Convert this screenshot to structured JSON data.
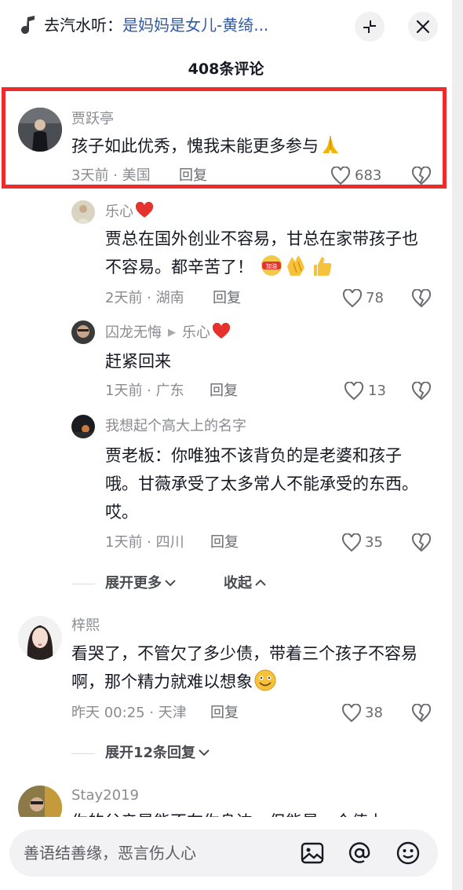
{
  "topbar": {
    "prefix": "去汽水听：",
    "song": "是妈妈是女儿-黄绮..."
  },
  "comments_count": "408条评论",
  "comments": [
    {
      "author": "贾跃亭",
      "text": "孩子如此优秀，愧我未能更多参与",
      "time_location": "3天前 · 美国",
      "reply": "回复",
      "likes": "683"
    },
    {
      "author": "乐心",
      "text": "贾总在国外创业不容易，甘总在家带孩子也不容易。都辛苦了！",
      "inline_emoji_label": "加油",
      "time_location": "2天前 · 湖南",
      "reply": "回复",
      "likes": "78"
    },
    {
      "author": "囚龙无悔",
      "reply_to": "乐心",
      "text": "赶紧回来",
      "time_location": "1天前 · 广东",
      "reply": "回复",
      "likes": "13"
    },
    {
      "author": "我想起个高大上的名字",
      "text": "贾老板：你唯独不该背负的是老婆和孩子哦。甘薇承受了太多常人不能承受的东西。哎。",
      "time_location": "1天前 · 四川",
      "reply": "回复",
      "likes": "35"
    },
    {
      "author": "梓熙",
      "text": "看哭了，不管欠了多少债，带着三个孩子不容易啊，那个精力就难以想象",
      "time_location": "昨天 00:25 · 天津",
      "reply": "回复",
      "likes": "38"
    },
    {
      "author": "Stay2019",
      "text": "你的父亲是能不在你身边，但能是一个值上"
    }
  ],
  "expand_more": "展开更多",
  "collapse": "收起",
  "expand_replies": "展开12条回复",
  "input": {
    "placeholder": "善语结善缘，恶言伤人心"
  },
  "colors": {
    "highlight": "#ee2b2b",
    "song_link": "#2e5aa8"
  }
}
